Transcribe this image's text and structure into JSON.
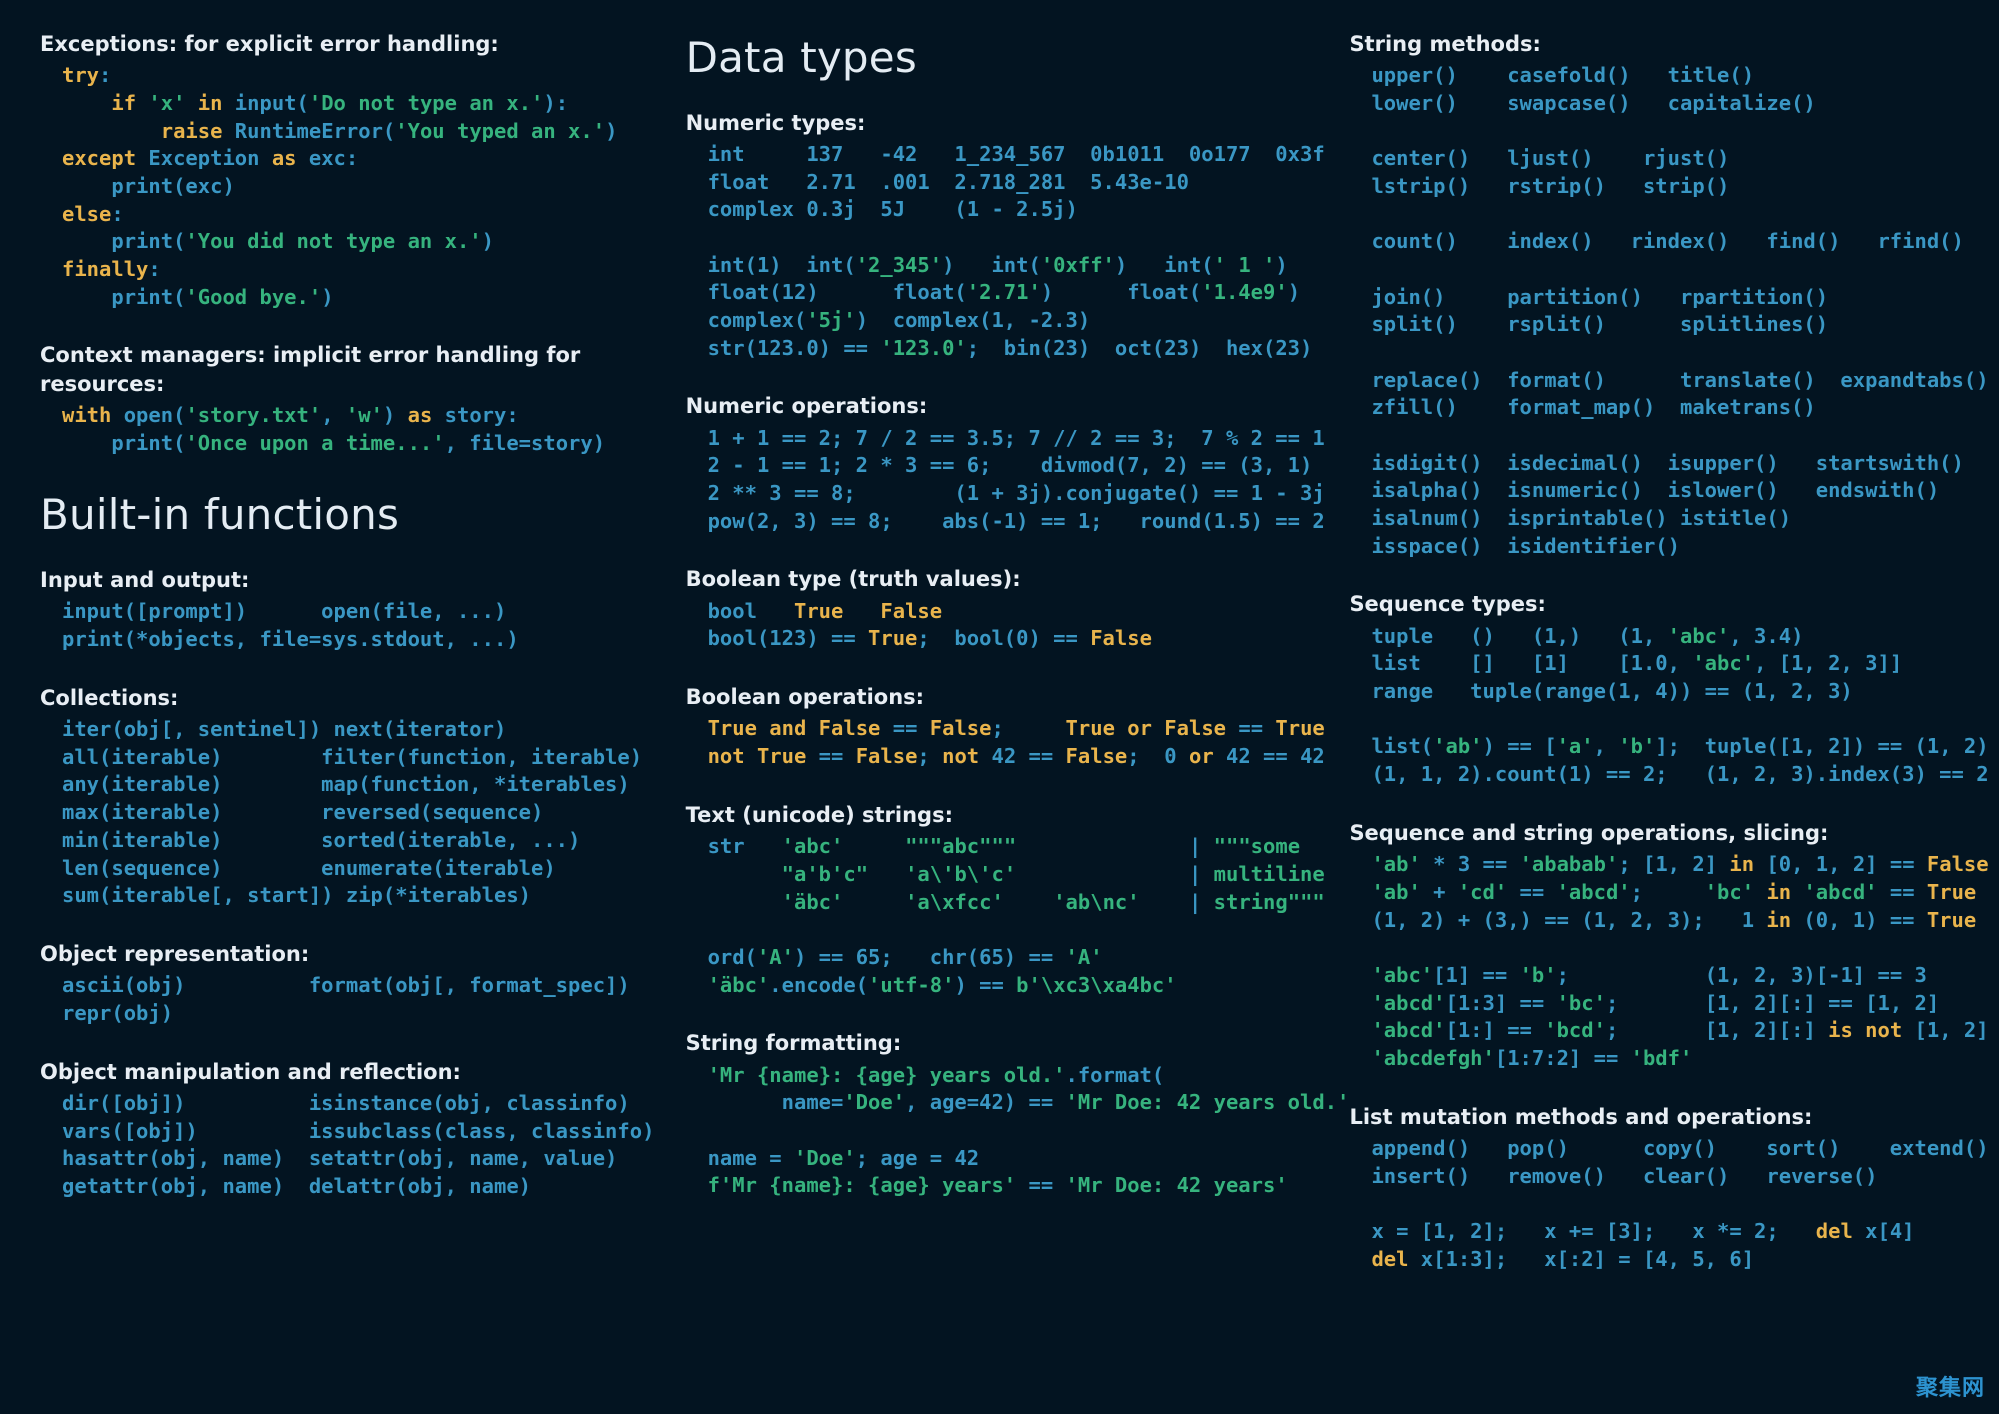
{
  "watermark": "聚集网",
  "col1": {
    "exceptions": {
      "title_html": "<b>Exceptions:</b> for explicit error handling:",
      "code_html": "<span class='kw'>try</span>:\n    <span class='kw'>if</span> <span class='str'>'x'</span> <span class='kw'>in</span> input(<span class='str'>'Do not type an x.'</span>):\n        <span class='kw'>raise</span> RuntimeError(<span class='str'>'You typed an x.'</span>)\n<span class='kw'>except</span> Exception <span class='kw'>as</span> exc:\n    print(exc)\n<span class='kw'>else</span>:\n    print(<span class='str'>'You did not type an x.'</span>)\n<span class='kw'>finally</span>:\n    print(<span class='str'>'Good bye.'</span>)"
    },
    "context_managers": {
      "title_html": "<b>Context managers:</b> implicit error handling for resources:",
      "code_html": "<span class='kw'>with</span> open(<span class='str'>'story.txt'</span>, <span class='str'>'w'</span>) <span class='kw'>as</span> story:\n    print(<span class='str'>'Once upon a time...'</span>, file=story)"
    },
    "heading": "Built-in functions",
    "io": {
      "title": "Input and output:",
      "code_html": "input([prompt])      open(file, ...)\nprint(*objects, file=sys.stdout, ...)"
    },
    "collections": {
      "title": "Collections:",
      "code_html": "iter(obj[, sentinel]) next(iterator)\nall(iterable)        filter(function, iterable)\nany(iterable)        map(function, *iterables)\nmax(iterable)        reversed(sequence)\nmin(iterable)        sorted(iterable, ...)\nlen(sequence)        enumerate(iterable)\nsum(iterable[, start]) zip(*iterables)"
    },
    "object_repr": {
      "title": "Object representation:",
      "code_html": "ascii(obj)          format(obj[, format_spec])\nrepr(obj)"
    },
    "object_manip": {
      "title": "Object manipulation and reflection:",
      "code_html": "dir([obj])          isinstance(obj, classinfo)\nvars([obj])         issubclass(class, classinfo)\nhasattr(obj, name)  setattr(obj, name, value)\ngetattr(obj, name)  delattr(obj, name)"
    }
  },
  "col2": {
    "heading": "Data types",
    "numeric_types": {
      "title": "Numeric types:",
      "code_html": "int     137   -42   1_234_567  0b1011  0o177  0x3f\nfloat   2.71  .001  2.718_281  5.43e-10\ncomplex 0.3j  5J    (1 - 2.5j)\n\nint(1)  int(<span class='str'>'2_345'</span>)   int(<span class='str'>'0xff'</span>)   int(<span class='str'>' 1 '</span>)\nfloat(12)      float(<span class='str'>'2.71'</span>)      float(<span class='str'>'1.4e9'</span>)\ncomplex(<span class='str'>'5j'</span>)  complex(1, -2.3)\nstr(123.0) == <span class='str'>'123.0'</span>;  bin(23)  oct(23)  hex(23)"
    },
    "numeric_ops": {
      "title": "Numeric operations:",
      "code_html": "1 + 1 == 2; 7 / 2 == 3.5; 7 // 2 == 3;  7 % 2 == 1\n2 - 1 == 1; 2 * 3 == 6;    divmod(7, 2) == (3, 1)\n2 ** 3 == 8;        (1 + 3j).conjugate() == 1 - 3j\npow(2, 3) == 8;    abs(-1) == 1;   round(1.5) == 2"
    },
    "boolean_type": {
      "title": "Boolean type (truth values):",
      "code_html": "bool   <span class='kw'>True</span>   <span class='kw'>False</span>\nbool(123) == <span class='kw'>True</span>;  bool(0) == <span class='kw'>False</span>"
    },
    "boolean_ops": {
      "title": "Boolean operations:",
      "code_html": "<span class='kw'>True</span> <span class='kw'>and</span> <span class='kw'>False</span> == <span class='kw'>False</span>;     <span class='kw'>True</span> <span class='kw'>or</span> <span class='kw'>False</span> == <span class='kw'>True</span>\n<span class='kw'>not</span> <span class='kw'>True</span> == <span class='kw'>False</span>; <span class='kw'>not</span> 42 == <span class='kw'>False</span>;  0 <span class='kw'>or</span> 42 == 42"
    },
    "text_strings": {
      "title": "Text (unicode) strings:",
      "code_html": "str   <span class='str'>'abc'</span>     <span class='str'>\"\"\"abc\"\"\"</span>              | <span class='str'>\"\"\"some</span>\n      <span class='str'>\"a'b'c\"</span>   <span class='str'>'a\\'b\\'c'</span>              | <span class='str'>multiline</span>\n      <span class='str'>'äbc'</span>     <span class='str'>'a\\xfcc'</span>    <span class='str'>'ab\\nc'</span>    | <span class='str'>string\"\"\"</span>\n\nord(<span class='str'>'A'</span>) == 65;   chr(65) == <span class='str'>'A'</span>\n<span class='str'>'äbc'</span>.encode(<span class='str'>'utf-8'</span>) == <span class='str'>b'\\xc3\\xa4bc'</span>"
    },
    "string_formatting": {
      "title": "String formatting:",
      "code_html": "<span class='str'>'Mr {name}: {age} years old.'</span>.format(\n      name=<span class='str'>'Doe'</span>, age=42) == <span class='str'>'Mr Doe: 42 years old.'</span>\n\nname = <span class='str'>'Doe'</span>; age = 42\n<span class='str'>f'Mr {name}: {age} years'</span> == <span class='str'>'Mr Doe: 42 years'</span>"
    }
  },
  "col3": {
    "string_methods": {
      "title": "String methods:",
      "code_html": "upper()    casefold()   title()\nlower()    swapcase()   capitalize()\n\ncenter()   ljust()    rjust()\nlstrip()   rstrip()   strip()\n\ncount()    index()   rindex()   find()   rfind()\n\njoin()     partition()   rpartition()\nsplit()    rsplit()      splitlines()\n\nreplace()  format()      translate()  expandtabs()\nzfill()    format_map()  maketrans()\n\nisdigit()  isdecimal()  isupper()   startswith()\nisalpha()  isnumeric()  islower()   endswith()\nisalnum()  isprintable() istitle()\nisspace()  isidentifier()"
    },
    "sequence_types": {
      "title": "Sequence types:",
      "code_html": "tuple   ()   (1,)   (1, <span class='str'>'abc'</span>, 3.4)\nlist    []   [1]    [1.0, <span class='str'>'abc'</span>, [1, 2, 3]]\nrange   tuple(range(1, 4)) == (1, 2, 3)\n\nlist(<span class='str'>'ab'</span>) == [<span class='str'>'a'</span>, <span class='str'>'b'</span>];  tuple([1, 2]) == (1, 2)\n(1, 1, 2).count(1) == 2;   (1, 2, 3).index(3) == 2"
    },
    "sequence_ops": {
      "title": "Sequence and string operations, slicing:",
      "code_html": "<span class='str'>'ab'</span> * 3 == <span class='str'>'ababab'</span>; [1, 2] <span class='kw'>in</span> [0, 1, 2] == <span class='kw'>False</span>\n<span class='str'>'ab'</span> + <span class='str'>'cd'</span> == <span class='str'>'abcd'</span>;     <span class='str'>'bc'</span> <span class='kw'>in</span> <span class='str'>'abcd'</span> == <span class='kw'>True</span>\n(1, 2) + (3,) == (1, 2, 3);   1 <span class='kw'>in</span> (0, 1) == <span class='kw'>True</span>\n\n<span class='str'>'abc'</span>[1] == <span class='str'>'b'</span>;           (1, 2, 3)[-1] == 3\n<span class='str'>'abcd'</span>[1:3] == <span class='str'>'bc'</span>;       [1, 2][:] == [1, 2]\n<span class='str'>'abcd'</span>[1:] == <span class='str'>'bcd'</span>;       [1, 2][:] <span class='kw'>is not</span> [1, 2]\n<span class='str'>'abcdefgh'</span>[1:7:2] == <span class='str'>'bdf'</span>"
    },
    "list_mutation": {
      "title": "List mutation methods and operations:",
      "code_html": "append()   pop()      copy()    sort()    extend()\ninsert()   remove()   clear()   reverse()\n\nx = [1, 2];   x += [3];   x *= 2;   <span class='kw'>del</span> x[4]\n<span class='kw'>del</span> x[1:3];   x[:2] = [4, 5, 6]"
    }
  }
}
